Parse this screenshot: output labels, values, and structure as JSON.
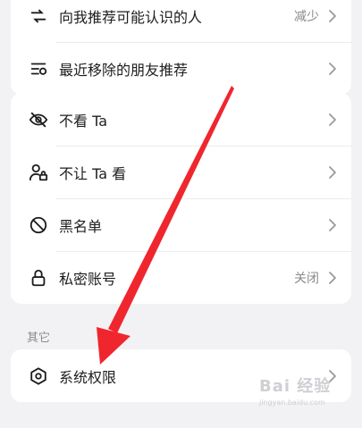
{
  "group1": {
    "items": [
      {
        "label": "向我推荐可能认识的人",
        "value": "减少",
        "icon": "people-sync-icon"
      },
      {
        "label": "最近移除的朋友推荐",
        "value": "",
        "icon": "list-removed-icon"
      }
    ]
  },
  "group2": {
    "items": [
      {
        "label": "不看 Ta",
        "value": "",
        "icon": "eye-off-icon"
      },
      {
        "label": "不让 Ta 看",
        "value": "",
        "icon": "user-lock-icon"
      },
      {
        "label": "黑名单",
        "value": "",
        "icon": "block-icon"
      },
      {
        "label": "私密账号",
        "value": "关闭",
        "icon": "lock-icon"
      }
    ]
  },
  "section_other": {
    "title": "其它"
  },
  "group3": {
    "items": [
      {
        "label": "系统权限",
        "value": "",
        "icon": "hexagon-settings-icon"
      }
    ]
  },
  "annotation": {
    "arrow_color": "#f0262e"
  },
  "watermark": {
    "text": "Bai 经验",
    "sub": "jingyan.baidu.com"
  }
}
